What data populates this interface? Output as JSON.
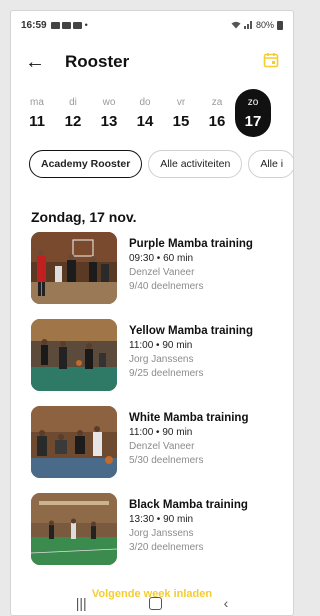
{
  "status": {
    "time": "16:59",
    "battery": "80%"
  },
  "header": {
    "back_icon": "arrow-left-icon",
    "title": "Rooster",
    "calendar_icon": "calendar-icon",
    "accent": "#f5cd2e"
  },
  "days": [
    {
      "name": "ma",
      "date": "11",
      "active": false
    },
    {
      "name": "di",
      "date": "12",
      "active": false
    },
    {
      "name": "wo",
      "date": "13",
      "active": false
    },
    {
      "name": "do",
      "date": "14",
      "active": false
    },
    {
      "name": "vr",
      "date": "15",
      "active": false
    },
    {
      "name": "za",
      "date": "16",
      "active": false
    },
    {
      "name": "zo",
      "date": "17",
      "active": true
    }
  ],
  "filters": [
    {
      "label": "Academy Rooster",
      "active": true
    },
    {
      "label": "Alle activiteiten",
      "active": false
    },
    {
      "label": "Alle i",
      "active": false
    }
  ],
  "date_heading": "Zondag, 17 nov.",
  "trainings": [
    {
      "name": "Purple Mamba training",
      "time": "09:30 • 60 min",
      "trainer": "Denzel Vaneer",
      "participants": "9/40 deelnemers",
      "scene": "purple"
    },
    {
      "name": "Yellow Mamba training",
      "time": "11:00 • 90 min",
      "trainer": "Jorg Janssens",
      "participants": "9/25 deelnemers",
      "scene": "yellow"
    },
    {
      "name": "White Mamba training",
      "time": "11:00 • 90 min",
      "trainer": "Denzel Vaneer",
      "participants": "5/30 deelnemers",
      "scene": "white"
    },
    {
      "name": "Black Mamba training",
      "time": "13:30 • 90 min",
      "trainer": "Jorg Janssens",
      "participants": "3/20 deelnemers",
      "scene": "black"
    }
  ],
  "load_more": "Volgende week inladen",
  "navbar": {
    "recent_icon": "recent-apps-icon",
    "home_icon": "home-icon",
    "back_icon": "back-chevron-icon"
  }
}
